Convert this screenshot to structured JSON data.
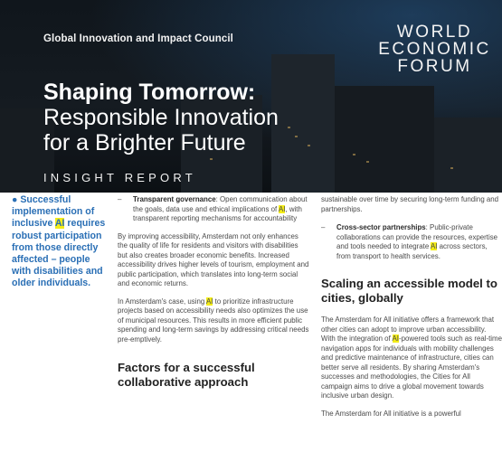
{
  "header": {
    "council": "Global Innovation and Impact Council",
    "logo_lines": [
      "WORLD",
      "ECONOMIC",
      "FORUM"
    ],
    "title_line1": "Shaping Tomorrow:",
    "title_line2": "Responsible Innovation",
    "title_line3": "for a Brighter Future",
    "report_type": "INSIGHT REPORT"
  },
  "sidebar": {
    "quote": "Successful implementation of inclusive AI requires robust participation from those directly affected – people with disabilities and older individuals."
  },
  "col2": {
    "item1_label": "Transparent governance",
    "item1_text": ": Open communication about the goals, data use and ethical implications of AI, with transparent reporting mechanisms for accountability",
    "para1": "By improving accessibility, Amsterdam not only enhances the quality of life for residents and visitors with disabilities but also creates broader economic benefits. Increased accessibility drives higher levels of tourism, employment and public participation, which translates into long-term social and economic returns.",
    "para2": "In Amsterdam's case, using AI to prioritize infrastructure projects based on accessibility needs also optimizes the use of municipal resources. This results in more efficient public spending and long-term savings by addressing critical needs pre-emptively.",
    "heading": "Factors for a successful collaborative approach"
  },
  "col3": {
    "continued": "sustainable over time by securing long-term funding and partnerships.",
    "item2_label": "Cross-sector partnerships",
    "item2_text": ": Public-private collaborations can provide the resources, expertise and tools needed to integrate AI across sectors, from transport to health services.",
    "heading": "Scaling an accessible model to cities, globally",
    "para1": "The Amsterdam for All initiative offers a framework that other cities can adopt to improve urban accessibility. With the integration of AI-powered tools such as real-time navigation apps for individuals with mobility challenges and predictive maintenance of infrastructure, cities can better serve all residents. By sharing Amsterdam's successes and methodologies, the Cities for All campaign aims to drive a global movement towards inclusive urban design.",
    "para2": "The Amsterdam for All initiative is a powerful"
  },
  "colors": {
    "accent_blue": "#2a6fb5",
    "highlight": "#f3ec18",
    "banner_dark": "#12181e"
  }
}
